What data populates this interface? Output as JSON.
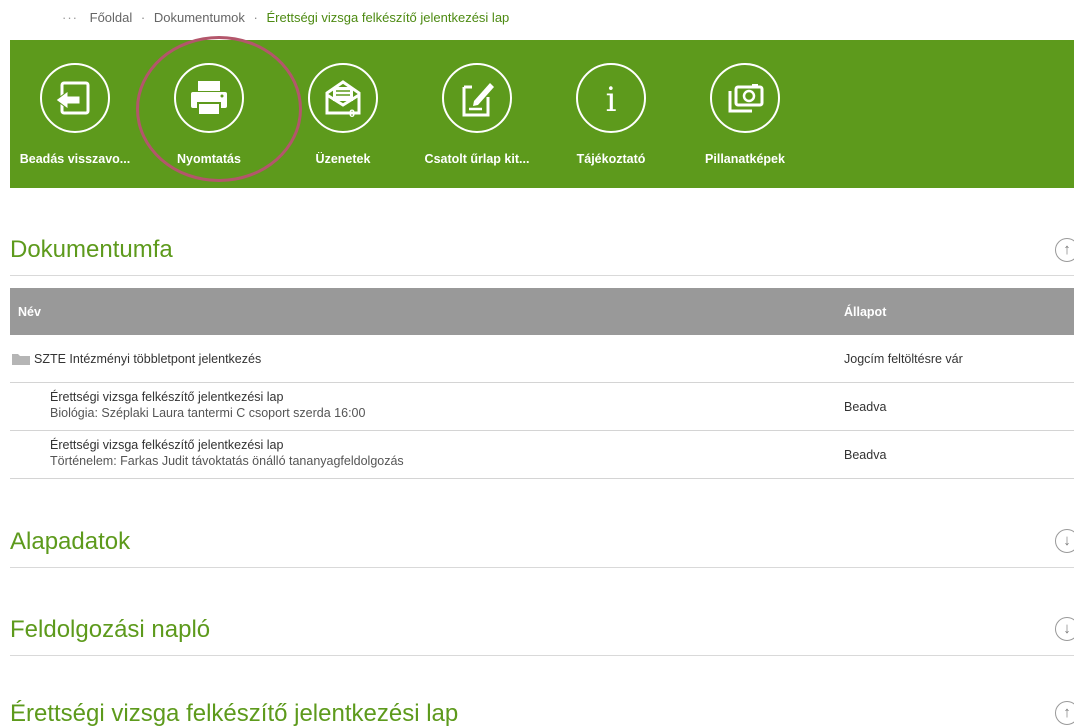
{
  "breadcrumb": {
    "dots": "···",
    "items": [
      "Főoldal",
      "Dokumentumok"
    ],
    "current": "Érettségi vizsga felkészítő jelentkezési lap"
  },
  "toolbar": {
    "buttons": [
      {
        "label": "Beadás visszavo...",
        "icon": "undo-icon"
      },
      {
        "label": "Nyomtatás",
        "icon": "print-icon"
      },
      {
        "label": "Üzenetek",
        "icon": "envelope-icon",
        "badge": "0"
      },
      {
        "label": "Csatolt űrlap kit...",
        "icon": "edit-document-icon"
      },
      {
        "label": "Tájékoztató",
        "icon": "info-icon"
      },
      {
        "label": "Pillanatképek",
        "icon": "camera-icon"
      }
    ]
  },
  "sections": {
    "dokumentumfa": "Dokumentumfa",
    "alapadatok": "Alapadatok",
    "feldolgozasi_naplo": "Feldolgozási napló",
    "erettsegi": "Érettségi vizsga felkészítő jelentkezési lap"
  },
  "table": {
    "headers": {
      "name": "Név",
      "status": "Állapot"
    },
    "rows": [
      {
        "line1": "SZTE Intézményi többletpont jelentkezés",
        "status": "Jogcím feltöltésre vár"
      },
      {
        "line1": "Érettségi vizsga felkészítő jelentkezési lap",
        "line2": "Biológia: Széplaki Laura tantermi C csoport szerda 16:00",
        "status": "Beadva"
      },
      {
        "line1": "Érettségi vizsga felkészítő jelentkezési lap",
        "line2": "Történelem: Farkas Judit távoktatás önálló tananyagfeldolgozás",
        "status": "Beadva"
      }
    ]
  },
  "colors": {
    "brand_green": "#5d9a1c",
    "header_gray": "#999999",
    "highlight": "#b3566b"
  }
}
